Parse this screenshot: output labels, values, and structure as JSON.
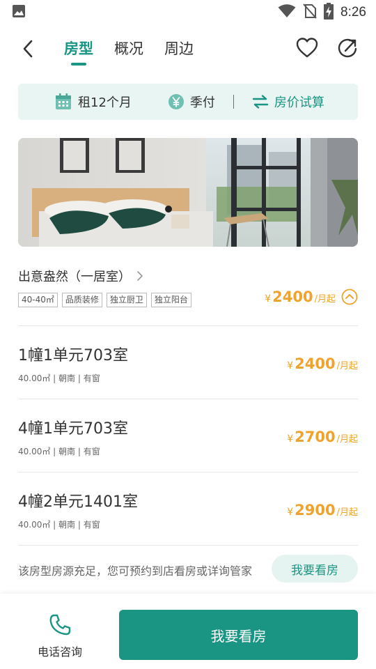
{
  "status_bar": {
    "time": "8:26"
  },
  "nav": {
    "tabs": [
      {
        "label": "房型",
        "active": true
      },
      {
        "label": "概况",
        "active": false
      },
      {
        "label": "周边",
        "active": false
      }
    ]
  },
  "info_strip": {
    "term": "租12个月",
    "payment": "季付",
    "calculator": "房价试算"
  },
  "room_type": {
    "title": "出意盎然（一居室）",
    "tags": [
      "40-40㎡",
      "品质装修",
      "独立厨卫",
      "独立阳台"
    ],
    "price": {
      "currency": "¥",
      "amount": "2400",
      "unit": "/月起"
    }
  },
  "rooms": [
    {
      "name": "1幢1单元703室",
      "meta": "40.00㎡ | 朝南 | 有窗",
      "currency": "¥",
      "amount": "2400",
      "unit": "/月起"
    },
    {
      "name": "4幢1单元703室",
      "meta": "40.00㎡ | 朝南 | 有窗",
      "currency": "¥",
      "amount": "2700",
      "unit": "/月起"
    },
    {
      "name": "4幢2单元1401室",
      "meta": "40.00㎡ | 朝南 | 有窗",
      "currency": "¥",
      "amount": "2900",
      "unit": "/月起"
    }
  ],
  "notice": {
    "text": "该房型房源充足，您可预约到店看房或详询管家",
    "button": "我要看房"
  },
  "bottom": {
    "phone_label": "电话咨询",
    "main_button": "我要看房"
  },
  "colors": {
    "accent": "#1a9483",
    "price": "#f0a32c",
    "strip_bg": "#e8f5f2"
  }
}
